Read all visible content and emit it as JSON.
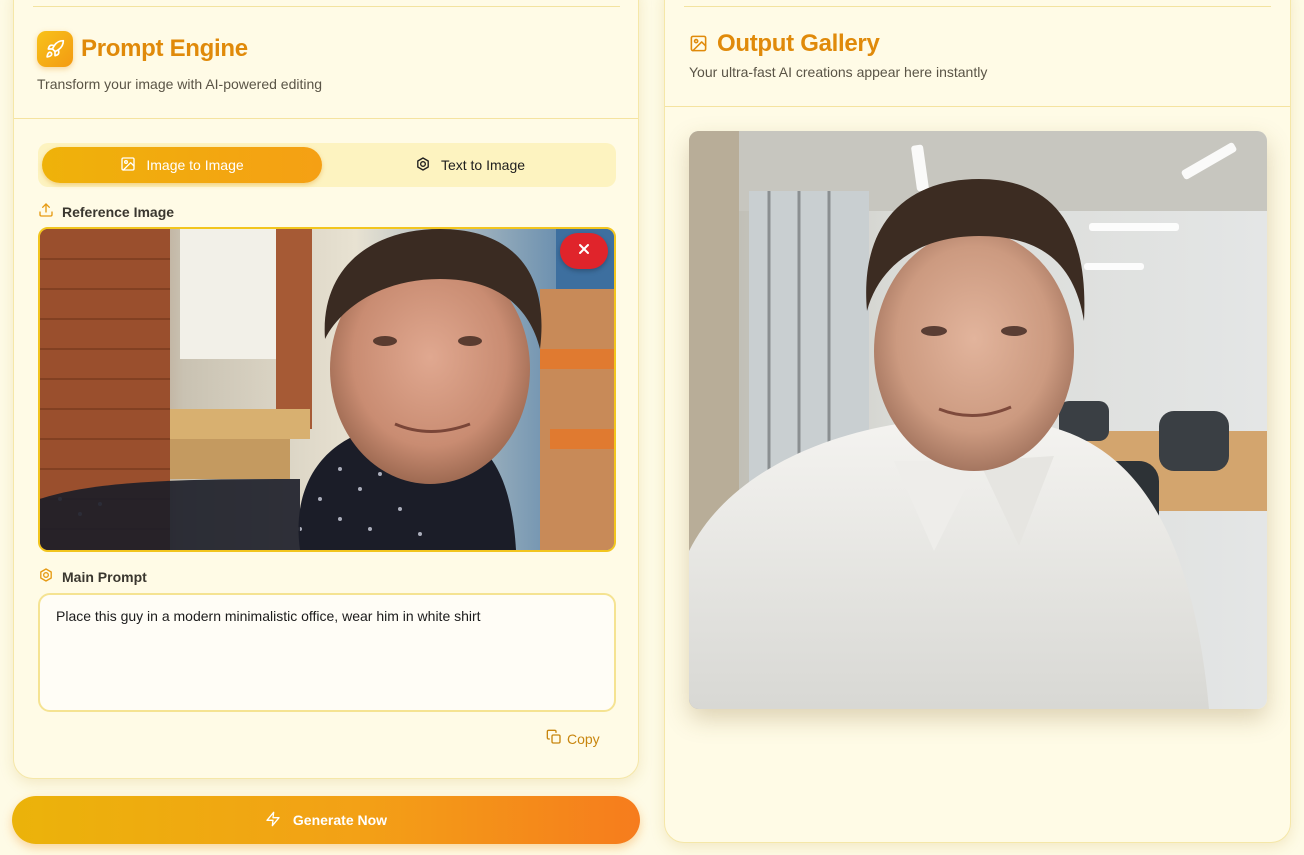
{
  "colors": {
    "accent": "#e08a0a",
    "active_toggle": "#efb20a",
    "danger": "#e0242b",
    "background": "#fefbe6"
  },
  "left_panel": {
    "title": "Prompt Engine",
    "subtitle": "Transform your image with AI-powered editing",
    "logo_icon": "rocket-icon",
    "mode_toggle": {
      "options": [
        {
          "label": "Image to Image",
          "icon": "image-icon",
          "active": true
        },
        {
          "label": "Text to Image",
          "icon": "aperture-icon",
          "active": false
        }
      ]
    },
    "reference_image": {
      "label": "Reference Image",
      "icon": "upload-icon",
      "remove_icon": "close-icon",
      "image_alt": "Selfie of a man in a dark patterned shirt inside a cafe"
    },
    "main_prompt": {
      "label": "Main Prompt",
      "icon": "aperture-icon",
      "value": "Place this guy in a modern minimalistic office, wear him in white shirt"
    },
    "copy_button": {
      "label": "Copy",
      "icon": "copy-icon"
    }
  },
  "generate_button": {
    "label": "Generate Now",
    "icon": "lightning-icon"
  },
  "right_panel": {
    "title": "Output Gallery",
    "subtitle": "Your ultra-fast AI creations appear here instantly",
    "icon": "image-icon",
    "output_image_alt": "Man in white shirt in a modern minimalistic office"
  }
}
